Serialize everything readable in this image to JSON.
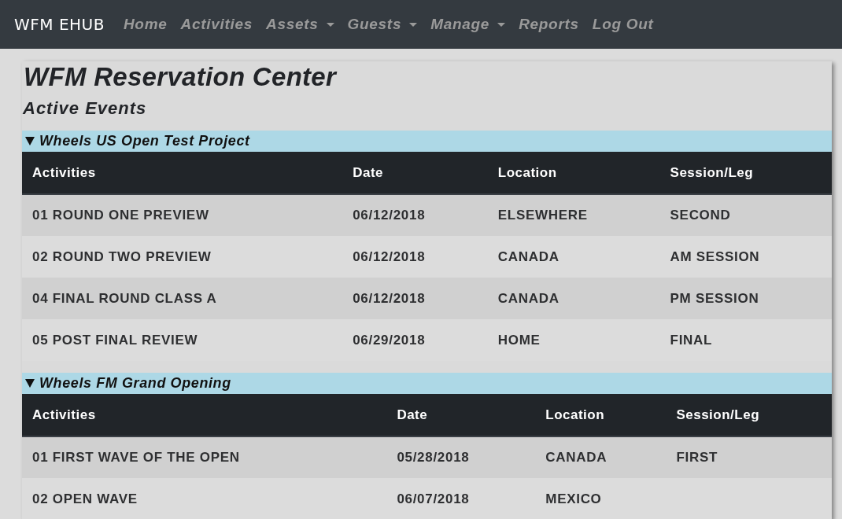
{
  "navbar": {
    "brand": "WFM EHUB",
    "links": [
      {
        "label": "Home",
        "dropdown": false
      },
      {
        "label": "Activities",
        "dropdown": false
      },
      {
        "label": "Assets",
        "dropdown": true
      },
      {
        "label": "Guests",
        "dropdown": true
      },
      {
        "label": "Manage",
        "dropdown": true
      },
      {
        "label": "Reports",
        "dropdown": false
      },
      {
        "label": "Log Out",
        "dropdown": false
      }
    ]
  },
  "page": {
    "title": "WFM Reservation Center",
    "subtitle": "Active Events"
  },
  "events": [
    {
      "name": "Wheels US Open Test Project",
      "expanded": true,
      "table": {
        "columns": [
          "Activities",
          "Date",
          "Location",
          "Session/Leg"
        ],
        "rows": [
          {
            "activity": "01 ROUND ONE PREVIEW",
            "date": "06/12/2018",
            "location": "ELSEWHERE",
            "session": "SECOND"
          },
          {
            "activity": "02 ROUND TWO PREVIEW",
            "date": "06/12/2018",
            "location": "CANADA",
            "session": "AM SESSION"
          },
          {
            "activity": "04 FINAL ROUND CLASS A",
            "date": "06/12/2018",
            "location": "CANADA",
            "session": "PM SESSION"
          },
          {
            "activity": "05 POST FINAL REVIEW",
            "date": "06/29/2018",
            "location": "HOME",
            "session": "FINAL"
          }
        ]
      }
    },
    {
      "name": "Wheels FM Grand Opening",
      "expanded": true,
      "table": {
        "columns": [
          "Activities",
          "Date",
          "Location",
          "Session/Leg"
        ],
        "rows": [
          {
            "activity": "01 FIRST WAVE OF THE OPEN",
            "date": "05/28/2018",
            "location": "CANADA",
            "session": "FIRST"
          },
          {
            "activity": "02 OPEN WAVE",
            "date": "06/07/2018",
            "location": "MEXICO"
          }
        ]
      }
    }
  ]
}
